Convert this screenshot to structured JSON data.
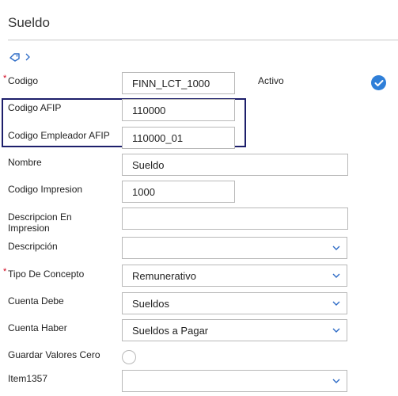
{
  "page": {
    "title": "Sueldo"
  },
  "breadcrumb": {
    "tag_icon": "tag-icon",
    "chevron_icon": "chevron-right-icon"
  },
  "form": {
    "codigo": {
      "label": "Codigo",
      "value": "FINN_LCT_1000",
      "required_mark": "*"
    },
    "activo": {
      "label": "Activo",
      "checked": true
    },
    "codigo_afip": {
      "label": "Codigo AFIP",
      "value": "110000"
    },
    "codigo_empleador_afip": {
      "label": "Codigo Empleador AFIP",
      "value": "110000_01"
    },
    "nombre": {
      "label": "Nombre",
      "value": "Sueldo"
    },
    "codigo_impresion": {
      "label": "Codigo Impresion",
      "value": "1000"
    },
    "descripcion_en_impresion": {
      "label": "Descripcion En Impresion",
      "value": ""
    },
    "descripcion": {
      "label": "Descripción",
      "value": ""
    },
    "tipo_de_concepto": {
      "label": "Tipo De Concepto",
      "value": "Remunerativo",
      "required_mark": "*"
    },
    "cuenta_debe": {
      "label": "Cuenta Debe",
      "value": "Sueldos"
    },
    "cuenta_haber": {
      "label": "Cuenta Haber",
      "value": "Sueldos a Pagar"
    },
    "guardar_valores_cero": {
      "label": "Guardar Valores Cero",
      "checked": false
    },
    "item1357": {
      "label": "Item1357",
      "value": ""
    }
  },
  "colors": {
    "accent": "#2f7fd8",
    "highlight_border": "#1d1f6b",
    "required": "#d0021b"
  }
}
